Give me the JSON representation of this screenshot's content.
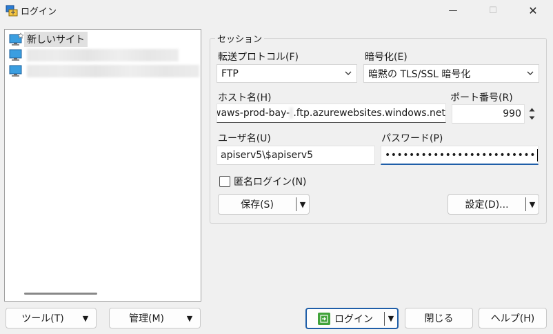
{
  "window": {
    "title": "ログイン",
    "minimize_glyph": "—",
    "maximize_glyph": "☐",
    "close_glyph": "✕"
  },
  "site_tree": {
    "items": [
      {
        "label": "新しいサイト",
        "icon": "monitor-new-site-icon",
        "selected": true
      },
      {
        "label": "",
        "icon": "monitor-icon",
        "redacted": true
      },
      {
        "label": "",
        "icon": "monitor-icon",
        "redacted": true
      }
    ]
  },
  "session": {
    "group_label": "セッション",
    "protocol": {
      "label": "転送プロトコル(F)",
      "value": "FTP"
    },
    "encryption": {
      "label": "暗号化(E)",
      "value": "暗黙の TLS/SSL 暗号化"
    },
    "host": {
      "label": "ホスト名(H)",
      "value_prefix": "waws-prod-bay-",
      "value_suffix": ".ftp.azurewebsites.windows.net"
    },
    "port": {
      "label": "ポート番号(R)",
      "value": "990"
    },
    "user": {
      "label": "ユーザ名(U)",
      "value": "apiserv5\\$apiserv5"
    },
    "password": {
      "label": "パスワード(P)",
      "value": "•••••••••••••••••••••••••"
    },
    "anonymous": {
      "label": "匿名ログイン(N)",
      "checked": false
    },
    "save_button": "保存(S)",
    "advanced_button": "設定(D)..."
  },
  "footer": {
    "tools_button": "ツール(T)",
    "manage_button": "管理(M)",
    "login_button": "ログイン",
    "close_button": "閉じる",
    "help_button": "ヘルプ(H)"
  },
  "colors": {
    "accent": "#1f5ea8",
    "login_icon": "#41a33b",
    "window_bg": "#f0f0f0"
  }
}
